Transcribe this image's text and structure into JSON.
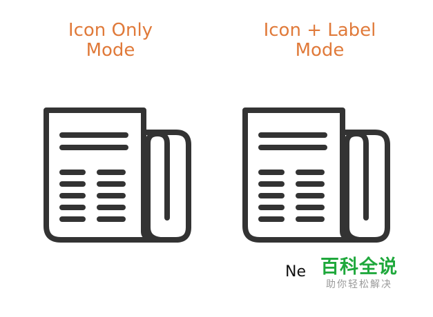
{
  "panels": [
    {
      "title_line1": "Icon Only",
      "title_line2": "Mode",
      "icon": "newspaper-icon"
    },
    {
      "title_line1": "Icon + Label",
      "title_line2": "Mode",
      "icon": "newspaper-icon",
      "label": "Ne"
    }
  ],
  "watermark": {
    "title": "百科全说",
    "subtitle": "助你轻松解决"
  },
  "colors": {
    "title": "#e07a3a",
    "icon_stroke": "#333333",
    "watermark_green": "#1fa83c",
    "watermark_gray": "#9a9a9a"
  }
}
